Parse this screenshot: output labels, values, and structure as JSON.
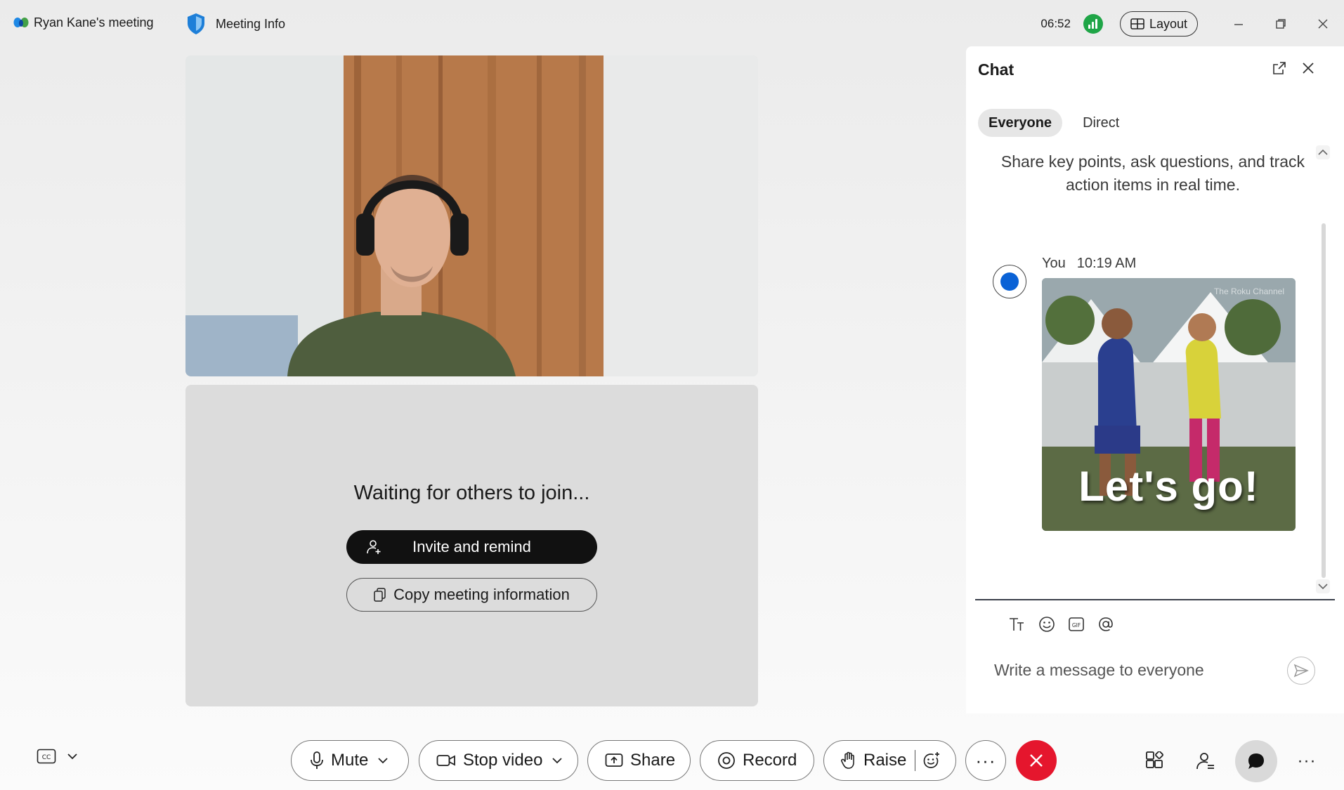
{
  "titlebar": {
    "meeting_title": "Ryan Kane's meeting",
    "meeting_info_label": "Meeting Info",
    "clock": "06:52",
    "layout_label": "Layout"
  },
  "stage": {
    "waiting_text": "Waiting for others to join...",
    "invite_label": "Invite and remind",
    "copy_label": "Copy meeting information"
  },
  "chat": {
    "title": "Chat",
    "tabs": [
      {
        "label": "Everyone",
        "active": true
      },
      {
        "label": "Direct",
        "active": false
      }
    ],
    "hint": "Share key points, ask questions, and track action items in real time.",
    "messages": [
      {
        "sender": "You",
        "time": "10:19 AM",
        "gif_caption": "Let's go!",
        "gif_watermark": "The Roku Channel"
      }
    ],
    "input_placeholder": "Write a message to everyone",
    "composer_icons": [
      "text-format-icon",
      "emoji-icon",
      "gif-icon",
      "mention-icon"
    ]
  },
  "controls": {
    "mute_label": "Mute",
    "video_label": "Stop video",
    "share_label": "Share",
    "record_label": "Record",
    "raise_label": "Raise",
    "more_label": "···",
    "bottom_more_label": "···"
  },
  "colors": {
    "end_call": "#e5162d",
    "signal": "#1fa547",
    "chat_avatar": "#0a62d6"
  }
}
